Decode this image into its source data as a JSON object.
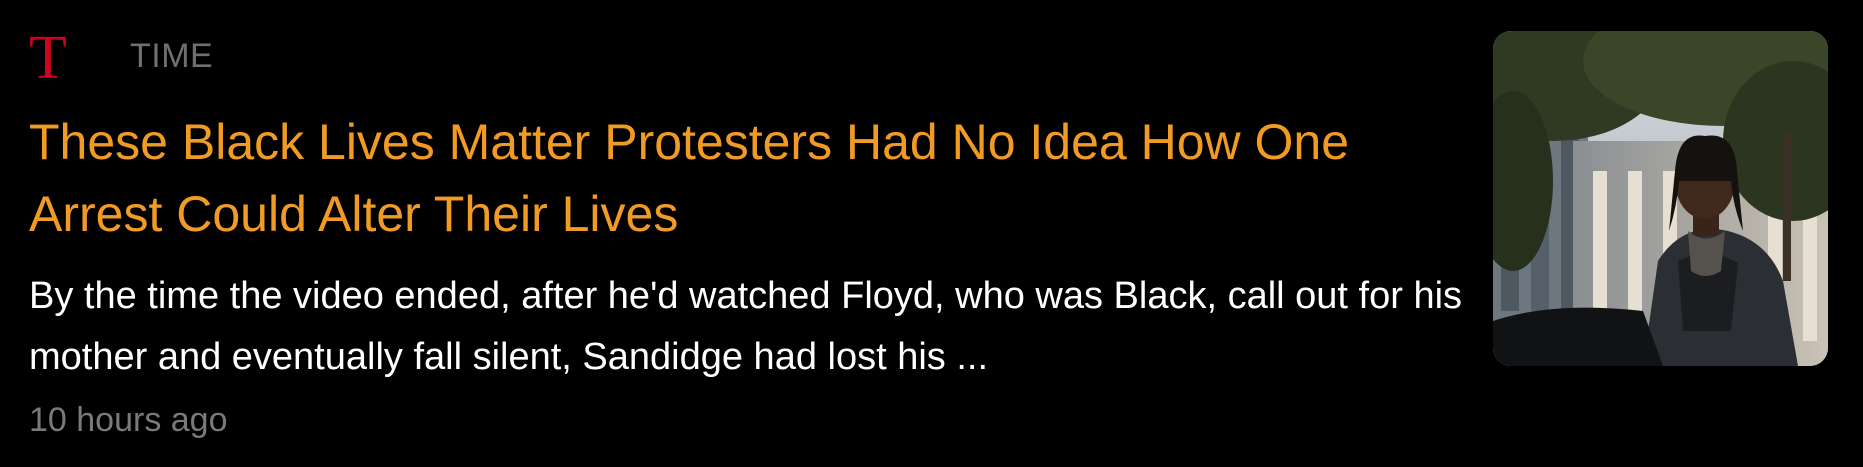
{
  "source": {
    "logo_letter": "T",
    "name": "TIME"
  },
  "article": {
    "headline": "These Black Lives Matter Protesters Had No Idea How One Arrest Could Alter Their Lives",
    "snippet": "By the time the video ended, after he'd watched Floyd, who was Black, call out for his mother and eventually fall silent, Sandidge had lost his ...",
    "timestamp": "10 hours ago"
  },
  "thumbnail": {
    "alt": "Portrait photo of a man outdoors near a building with trees"
  },
  "colors": {
    "background": "#000000",
    "headline": "#f29b24",
    "snippet": "#ffffff",
    "meta": "#7a7a7a",
    "logo": "#d0021b"
  }
}
